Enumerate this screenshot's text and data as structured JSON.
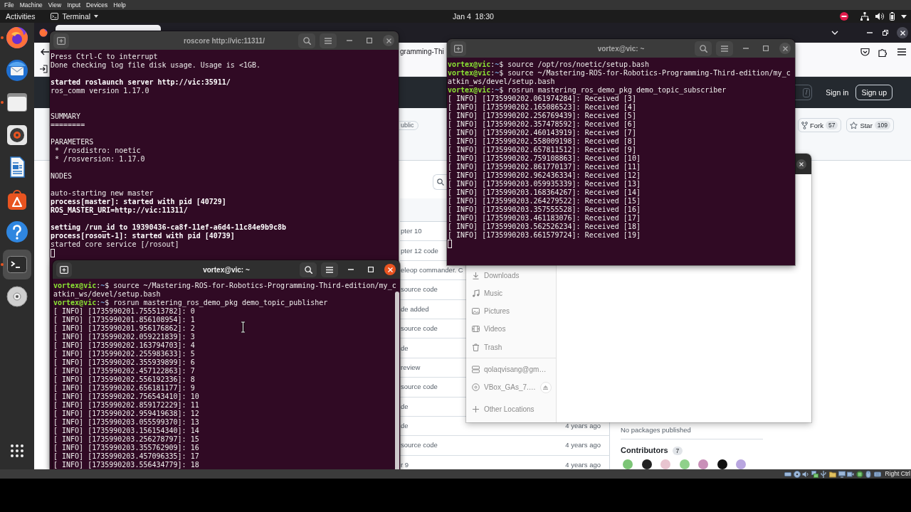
{
  "host_menu": [
    "File",
    "Machine",
    "View",
    "Input",
    "Devices",
    "Help"
  ],
  "top_bar": {
    "activities": "Activities",
    "app_menu": "Terminal",
    "clock": "Jan 4  18:30"
  },
  "dock": {
    "apps": [
      {
        "running": true,
        "selected": false
      },
      {
        "running": false,
        "selected": false
      },
      {
        "running": true,
        "selected": false
      },
      {
        "running": false,
        "selected": false
      },
      {
        "running": false,
        "selected": false
      },
      {
        "running": false,
        "selected": false
      },
      {
        "running": false,
        "selected": false
      },
      {
        "running": true,
        "selected": true
      },
      {
        "running": false,
        "selected": false
      }
    ]
  },
  "browser": {
    "address": "gramming-Thi",
    "site_header": {
      "search_shortcut": "/",
      "sign_in": "Sign in",
      "sign_up": "Sign up"
    },
    "repo": {
      "visibility": "ublic",
      "fork": {
        "label": "Fork",
        "count": "57"
      },
      "star": {
        "label": "Star",
        "count": "109"
      }
    },
    "file_rows": [
      {
        "text": "pter 10"
      },
      {
        "text": "pter 12 code"
      },
      {
        "text": "eleop commander. C"
      },
      {
        "text": "source code"
      },
      {
        "text": "de added"
      },
      {
        "text": "source code"
      },
      {
        "text": "de"
      },
      {
        "text": "review"
      },
      {
        "text": "source code"
      },
      {
        "text": "de"
      },
      {
        "text": "de",
        "time": "4 years ago"
      },
      {
        "text": "source code",
        "time": "4 years ago"
      },
      {
        "text": "r 9",
        "time": "4 years ago"
      }
    ],
    "side": {
      "packages": "No packages published",
      "contributors": {
        "title": "Contributors",
        "count": "7"
      }
    }
  },
  "file_manager": {
    "places": [
      {
        "label": "Downloads"
      },
      {
        "label": "Music"
      },
      {
        "label": "Pictures"
      },
      {
        "label": "Videos"
      },
      {
        "label": "Trash"
      }
    ],
    "devices": [
      {
        "label": "qolaqvisang@gm…",
        "eject": false
      },
      {
        "label": "VBox_GAs_7.…",
        "eject": true
      }
    ],
    "other_locations": "Other Locations"
  },
  "terminals": [
    {
      "title": "roscore http://vic:11311/",
      "focused": false,
      "cursor": true,
      "lines": [
        {
          "kind": "output",
          "text": "Press Ctrl-C to interrupt",
          "bold": false
        },
        {
          "kind": "output",
          "text": "Done checking log file disk usage. Usage is <1GB.",
          "bold": false
        },
        {
          "kind": "blank"
        },
        {
          "kind": "output",
          "text": "started roslaunch server http://vic:35911/",
          "bold": true
        },
        {
          "kind": "output",
          "text": "ros_comm version 1.17.0",
          "bold": false
        },
        {
          "kind": "blank"
        },
        {
          "kind": "blank"
        },
        {
          "kind": "output",
          "text": "SUMMARY",
          "bold": false
        },
        {
          "kind": "output",
          "text": "========",
          "bold": false
        },
        {
          "kind": "blank"
        },
        {
          "kind": "output",
          "text": "PARAMETERS",
          "bold": false
        },
        {
          "kind": "output",
          "text": " * /rosdistro: noetic",
          "bold": false
        },
        {
          "kind": "output",
          "text": " * /rosversion: 1.17.0",
          "bold": false
        },
        {
          "kind": "blank"
        },
        {
          "kind": "output",
          "text": "NODES",
          "bold": false
        },
        {
          "kind": "blank"
        },
        {
          "kind": "output",
          "text": "auto-starting new master",
          "bold": false
        },
        {
          "kind": "output",
          "text": "process[master]: started with pid [40729]",
          "bold": true
        },
        {
          "kind": "output",
          "text": "ROS_MASTER_URI=http://vic:11311/",
          "bold": true
        },
        {
          "kind": "blank"
        },
        {
          "kind": "output",
          "text": "setting /run_id to 19390436-ca8f-11ef-a6d4-11c84e9b9c8b",
          "bold": true
        },
        {
          "kind": "output",
          "text": "process[rosout-1]: started with pid [40739]",
          "bold": true
        },
        {
          "kind": "output",
          "text": "started core service [/rosout]",
          "bold": false
        }
      ]
    },
    {
      "title": "vortex@vic: ~",
      "focused": false,
      "cursor": true,
      "lines": [
        {
          "kind": "prompt",
          "user_host": "vortex@vic",
          "separator": ":",
          "path": "~",
          "symbol": "$",
          "command": "source /opt/ros/noetic/setup.bash"
        },
        {
          "kind": "prompt",
          "user_host": "vortex@vic",
          "separator": ":",
          "path": "~",
          "symbol": "$",
          "command": "source ~/Mastering-ROS-for-Robotics-Programming-Third-edition/my_catkin_ws/devel/setup.bash"
        },
        {
          "kind": "prompt",
          "user_host": "vortex@vic",
          "separator": ":",
          "path": "~",
          "symbol": "$",
          "command": "rosrun mastering_ros_demo_pkg demo_topic_subscriber"
        },
        {
          "kind": "output",
          "text": "[ INFO] [1735990202.061974284]: Received [3]",
          "bold": false
        },
        {
          "kind": "output",
          "text": "[ INFO] [1735990202.165086523]: Received [4]",
          "bold": false
        },
        {
          "kind": "output",
          "text": "[ INFO] [1735990202.256769439]: Received [5]",
          "bold": false
        },
        {
          "kind": "output",
          "text": "[ INFO] [1735990202.357478592]: Received [6]",
          "bold": false
        },
        {
          "kind": "output",
          "text": "[ INFO] [1735990202.460143919]: Received [7]",
          "bold": false
        },
        {
          "kind": "output",
          "text": "[ INFO] [1735990202.558009198]: Received [8]",
          "bold": false
        },
        {
          "kind": "output",
          "text": "[ INFO] [1735990202.657811512]: Received [9]",
          "bold": false
        },
        {
          "kind": "output",
          "text": "[ INFO] [1735990202.759108863]: Received [10]",
          "bold": false
        },
        {
          "kind": "output",
          "text": "[ INFO] [1735990202.861770137]: Received [11]",
          "bold": false
        },
        {
          "kind": "output",
          "text": "[ INFO] [1735990202.962436334]: Received [12]",
          "bold": false
        },
        {
          "kind": "output",
          "text": "[ INFO] [1735990203.059935339]: Received [13]",
          "bold": false
        },
        {
          "kind": "output",
          "text": "[ INFO] [1735990203.168364267]: Received [14]",
          "bold": false
        },
        {
          "kind": "output",
          "text": "[ INFO] [1735990203.264279522]: Received [15]",
          "bold": false
        },
        {
          "kind": "output",
          "text": "[ INFO] [1735990203.357555528]: Received [16]",
          "bold": false
        },
        {
          "kind": "output",
          "text": "[ INFO] [1735990203.461183076]: Received [17]",
          "bold": false
        },
        {
          "kind": "output",
          "text": "[ INFO] [1735990203.562526234]: Received [18]",
          "bold": false
        },
        {
          "kind": "output",
          "text": "[ INFO] [1735990203.661579724]: Received [19]",
          "bold": false
        }
      ]
    },
    {
      "title": "vortex@vic: ~",
      "focused": true,
      "lines": [
        {
          "kind": "prompt",
          "user_host": "vortex@vic",
          "separator": ":",
          "path": "~",
          "symbol": "$",
          "command": "source ~/Mastering-ROS-for-Robotics-Programming-Third-edition/my_catkin_ws/devel/setup.bash"
        },
        {
          "kind": "prompt",
          "user_host": "vortex@vic",
          "separator": ":",
          "path": "~",
          "symbol": "$",
          "command": "rosrun mastering_ros_demo_pkg demo_topic_publisher"
        },
        {
          "kind": "output",
          "text": "[ INFO] [1735990201.755513782]: 0",
          "bold": false
        },
        {
          "kind": "output",
          "text": "[ INFO] [1735990201.856108954]: 1",
          "bold": false
        },
        {
          "kind": "output",
          "text": "[ INFO] [1735990201.956176862]: 2",
          "bold": false
        },
        {
          "kind": "output",
          "text": "[ INFO] [1735990202.059221839]: 3",
          "bold": false
        },
        {
          "kind": "output",
          "text": "[ INFO] [1735990202.163794703]: 4",
          "bold": false
        },
        {
          "kind": "output",
          "text": "[ INFO] [1735990202.255983633]: 5",
          "bold": false
        },
        {
          "kind": "output",
          "text": "[ INFO] [1735990202.355939899]: 6",
          "bold": false
        },
        {
          "kind": "output",
          "text": "[ INFO] [1735990202.457122863]: 7",
          "bold": false
        },
        {
          "kind": "output",
          "text": "[ INFO] [1735990202.556192336]: 8",
          "bold": false
        },
        {
          "kind": "output",
          "text": "[ INFO] [1735990202.656181177]: 9",
          "bold": false
        },
        {
          "kind": "output",
          "text": "[ INFO] [1735990202.756543410]: 10",
          "bold": false
        },
        {
          "kind": "output",
          "text": "[ INFO] [1735990202.859172229]: 11",
          "bold": false
        },
        {
          "kind": "output",
          "text": "[ INFO] [1735990202.959419638]: 12",
          "bold": false
        },
        {
          "kind": "output",
          "text": "[ INFO] [1735990203.055599370]: 13",
          "bold": false
        },
        {
          "kind": "output",
          "text": "[ INFO] [1735990203.156154340]: 14",
          "bold": false
        },
        {
          "kind": "output",
          "text": "[ INFO] [1735990203.256278797]: 15",
          "bold": false
        },
        {
          "kind": "output",
          "text": "[ INFO] [1735990203.355762909]: 16",
          "bold": false
        },
        {
          "kind": "output",
          "text": "[ INFO] [1735990203.457096335]: 17",
          "bold": false
        },
        {
          "kind": "output",
          "text": "[ INFO] [1735990203.556434779]: 18",
          "bold": false
        }
      ]
    }
  ],
  "status_bar": {
    "host_key": "Right Ctrl"
  }
}
